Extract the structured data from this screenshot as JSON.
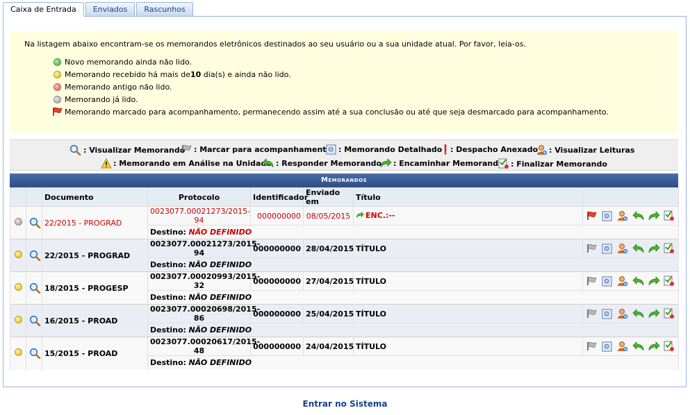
{
  "tabs": [
    "Caixa de Entrada",
    "Enviados",
    "Rascunhos"
  ],
  "info": {
    "intro": "Na listagem abaixo encontram-se os memorandos eletrônicos destinados ao seu usuário ou a sua unidade atual. Por favor, leia-os.",
    "legend": [
      {
        "icon": "green-dot",
        "text": "Novo memorando ainda não lido."
      },
      {
        "icon": "yellow-dot",
        "text_before": "Memorando recebido há mais de ",
        "days": "10",
        "text_after": " dia(s) e ainda não lido."
      },
      {
        "icon": "red-dot",
        "text": "Memorando antigo não lido."
      },
      {
        "icon": "gray-dot",
        "text": "Memorando já lido."
      },
      {
        "icon": "red-flag",
        "text": "Memorando marcado para acompanhamento, permanecendo assim até a sua conclusão ou até que seja desmarcado para acompanhamento."
      }
    ]
  },
  "icon_legend": {
    "row1": [
      ": Visualizar Memorando",
      ": Marcar para acompanhamento",
      ": Memorando Detalhado",
      ": Despacho Anexado",
      ": Visualizar Leituras"
    ],
    "row2": [
      ": Memorando em Análise na Unidade",
      ": Responder Memorando",
      ": Encaminhar Memorando",
      ": Finalizar Memorando"
    ]
  },
  "table": {
    "caption": "Memorandos",
    "headers": [
      "Documento",
      "Protocolo",
      "Identificador",
      "Enviado em",
      "Título"
    ],
    "dest_label": "Destino:",
    "rows": [
      {
        "status": "gray",
        "documento": "22/2015 - PROGRAD",
        "protocolo": "0023077.00021273/2015-94",
        "identificador": "000000000",
        "enviado": "08/05/2015",
        "titulo": "ENC.:--",
        "destino": "NÃO DEFINIDO",
        "highlight": true
      },
      {
        "status": "yellow",
        "documento": "22/2015 - PROGRAD",
        "protocolo": "0023077.00021273/2015-94",
        "identificador": "000000000",
        "enviado": "28/04/2015",
        "titulo": "TÍTULO",
        "destino": "NÃO DEFINIDO",
        "highlight": false
      },
      {
        "status": "yellow",
        "documento": "18/2015 - PROGESP",
        "protocolo": "0023077.00020993/2015-32",
        "identificador": "000000000",
        "enviado": "27/04/2015",
        "titulo": "TÍTULO",
        "destino": "NÃO DEFINIDO",
        "highlight": false
      },
      {
        "status": "yellow",
        "documento": "16/2015 - PROAD",
        "protocolo": "0023077.00020698/2015-86",
        "identificador": "000000000",
        "enviado": "25/04/2015",
        "titulo": "TÍTULO",
        "destino": "NÃO DEFINIDO",
        "highlight": false
      },
      {
        "status": "yellow",
        "documento": "15/2015 - PROAD",
        "protocolo": "0023077.00020617/2015-48",
        "identificador": "000000000",
        "enviado": "24/04/2015",
        "titulo": "TÍTULO",
        "destino": "NÃO DEFINIDO",
        "highlight": false
      }
    ]
  },
  "footer": {
    "link": "Entrar no Sistema"
  },
  "colors": {
    "accent": "#15428b",
    "info_bg": "#ffffe0",
    "caption_bg": "#3b5d95",
    "alert_red": "#cc0000"
  }
}
